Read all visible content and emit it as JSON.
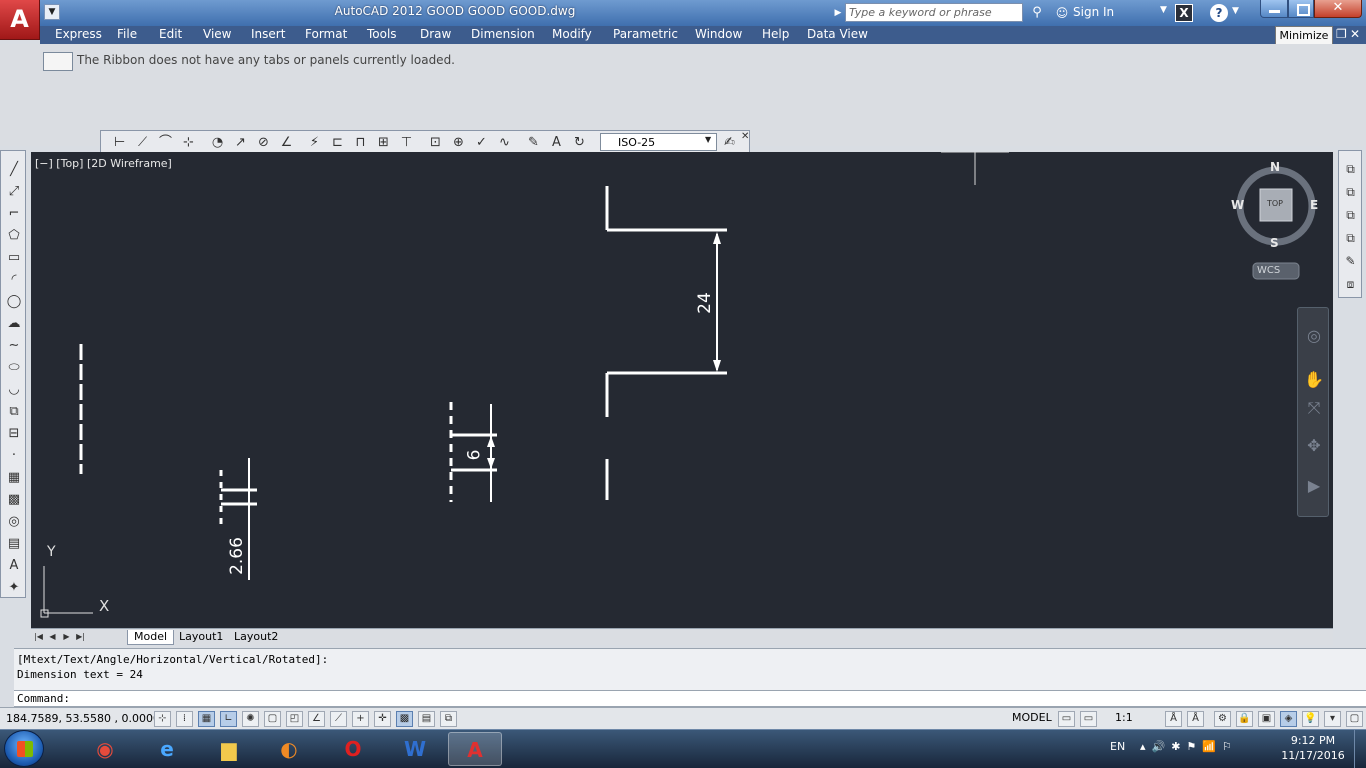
{
  "app": {
    "logo": "A",
    "title": "AutoCAD 2012    GOOD GOOD GOOD.dwg"
  },
  "search": {
    "placeholder": "Type a keyword or phrase"
  },
  "account": {
    "sign_in": "Sign In"
  },
  "tooltip": "Minimize",
  "menu": [
    "Express",
    "File",
    "Edit",
    "View",
    "Insert",
    "Format",
    "Tools",
    "Draw",
    "Dimension",
    "Modify",
    "Parametric",
    "Window",
    "Help",
    "Data View"
  ],
  "ribbon": {
    "message": "The Ribbon does not have any tabs or panels currently loaded."
  },
  "dim_toolbar": {
    "style": "ISO-25"
  },
  "viewport": {
    "label": "[−] [Top] [2D Wireframe]"
  },
  "viewcube": {
    "n": "N",
    "s": "S",
    "e": "E",
    "w": "W",
    "top": "TOP",
    "wcs": "WCS"
  },
  "ucs": {
    "x": "X",
    "y": "Y"
  },
  "drawing": {
    "dims": [
      "24",
      "6",
      "2.66"
    ]
  },
  "layout_tabs": [
    "Model",
    "Layout1",
    "Layout2"
  ],
  "command": {
    "history": [
      "[Mtext/Text/Angle/Horizontal/Vertical/Rotated]:",
      "Dimension text = 24"
    ],
    "prompt": "Command:"
  },
  "status": {
    "coords": "184.7589, 53.5580 , 0.0000",
    "model": "MODEL",
    "scale": "1:1"
  },
  "taskbar": {
    "lang": "EN",
    "time": "9:12 PM",
    "date": "11/17/2016"
  },
  "colors": {
    "menu_bar": "#3d5c8d",
    "canvas": "#252932",
    "title_bar": "#4f7fbe",
    "autocad_red": "#c42a2a"
  }
}
